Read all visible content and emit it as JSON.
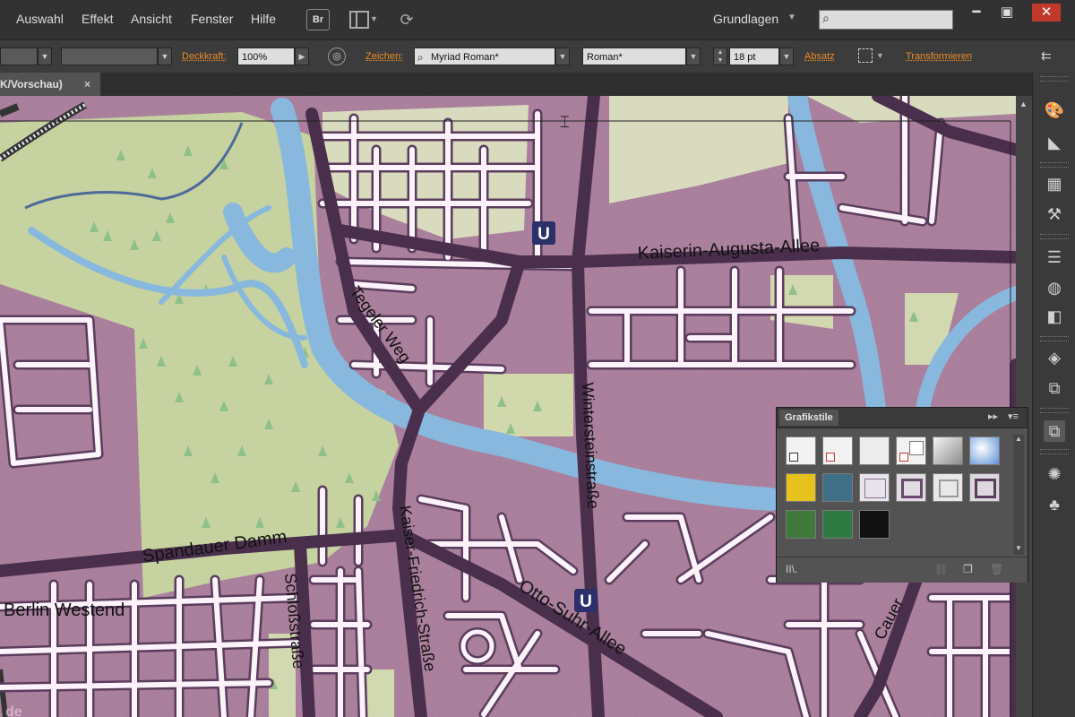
{
  "menu": {
    "items": [
      "Auswahl",
      "Effekt",
      "Ansicht",
      "Fenster",
      "Hilfe"
    ],
    "bridge_label": "Br",
    "workspace": "Grundlagen",
    "search_placeholder": ""
  },
  "control": {
    "opacity_label": "Deckkraft:",
    "opacity_value": "100%",
    "character_label": "Zeichen:",
    "font_family": "Myriad Roman*",
    "font_style": "Roman*",
    "font_size": "18 pt",
    "paragraph_label": "Absatz",
    "transform_label": "Transformieren"
  },
  "document_tab": {
    "title": "K/Vorschau)",
    "close": "×"
  },
  "panel": {
    "title": "Grafikstile",
    "expand": "▸▸",
    "menu": "▾≡",
    "library": "II\\.",
    "swatches": [
      "empty-default",
      "empty-default-2",
      "plain-gray",
      "default-dual",
      "gray-gradient",
      "blue-gradient",
      "yellow-texture",
      "blue-pattern",
      "light-frame",
      "purple-frame",
      "gray-frame",
      "purple-frame-2",
      "green-texture",
      "green-pattern",
      "black-fill"
    ]
  },
  "map": {
    "streets": [
      "Kaiserin-Augusta-Allee",
      "Tegeler Weg",
      "Wintersteinstraße",
      "Spandauer Damm",
      "Kaiser-Friedrich-Straße",
      "Otto-Suhr-Allee",
      "Schloßstraße",
      "Cauer"
    ],
    "places": [
      "Berlin Westend"
    ],
    "ubahn_symbol": "U",
    "watermark": "de"
  },
  "colors": {
    "block": "#a8789a",
    "park": "#c6d2a0",
    "water": "#88b8dd",
    "street_casing": "#4a2f4d",
    "street_fill": "#ffffff",
    "orange_label": "#ea8c2a"
  }
}
